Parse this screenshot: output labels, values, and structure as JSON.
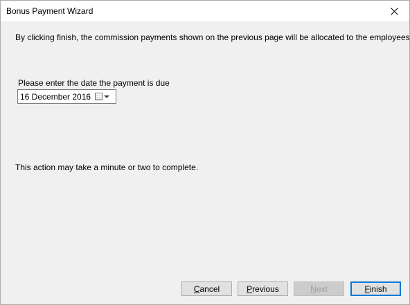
{
  "window": {
    "title": "Bonus Payment Wizard"
  },
  "icons": {
    "close": "close-icon",
    "calendar": "calendar-icon",
    "dropdown": "chevron-down-icon"
  },
  "content": {
    "intro_text": "By clicking finish, the commission payments shown on the previous page will be allocated to the employees.",
    "date_label": "Please enter the date the payment is due",
    "date_value": "16 December 2016",
    "note_text": "This action may take a minute or two to complete."
  },
  "buttons": {
    "cancel": {
      "mnemonic": "C",
      "rest": "ancel"
    },
    "previous": {
      "mnemonic": "P",
      "rest": "revious"
    },
    "next": {
      "mnemonic": "N",
      "rest": "ext"
    },
    "finish": {
      "mnemonic": "F",
      "rest": "inish"
    }
  },
  "colors": {
    "dialog_background": "#f0f0f0",
    "title_bar": "#ffffff",
    "default_button_border": "#0078d7",
    "disabled_text": "#a0a0a0"
  }
}
